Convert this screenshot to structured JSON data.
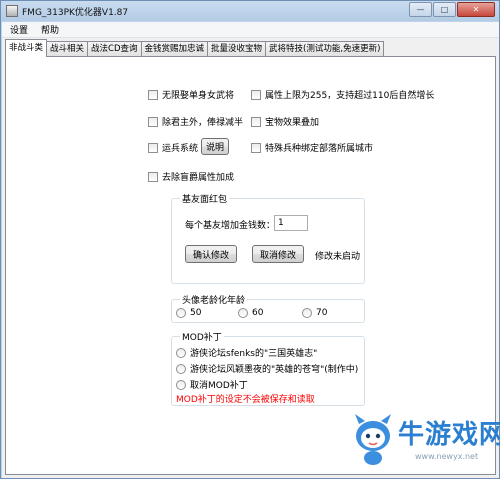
{
  "window": {
    "title": "FMG_313PK优化器V1.87"
  },
  "menu": [
    "设置",
    "帮助"
  ],
  "tabs": [
    "非战斗类",
    "战斗相关",
    "战法CD查询",
    "金钱赏赐加忠诚",
    "批量没收宝物",
    "武将特技(测试功能,免速更新)"
  ],
  "options": {
    "no_female_single": "无限娶单身女武将",
    "attr_limit_255": "属性上限为255，支持超过110后自然增长",
    "exclude_lord_salary": "除君主外，俸禄减半",
    "treasure_stack": "宝物效果叠加",
    "transport_system": "运兵系统",
    "explain_button": "说明",
    "special_troops_bind": "特殊兵种绑定部落所属城市",
    "remove_blind": "去除盲爵属性加成"
  },
  "red_envelope": {
    "title": "基友面红包",
    "money_label": "每个基友增加金钱数：",
    "money_value": "1",
    "confirm_button": "确认修改",
    "cancel_button": "取消修改",
    "status": "修改未启动"
  },
  "avatar_aging": {
    "title": "头像老龄化年龄",
    "ages": [
      "50",
      "60",
      "70"
    ]
  },
  "mod_patch": {
    "title": "MOD补丁",
    "options": [
      "游侠论坛sfenks的\"三国英雄志\"",
      "游侠论坛风颖墨夜的\"英雄的苍穹\"(制作中)",
      "取消MOD补丁"
    ],
    "warning": "MOD补丁的设定不会被保存和读取"
  },
  "watermark": {
    "brand": "牛游戏网",
    "url": "www.newyx.net"
  },
  "colors": {
    "window_frame": "#bcd3ea",
    "warning": "#ff0000",
    "watermark": "#2a7fd0"
  }
}
